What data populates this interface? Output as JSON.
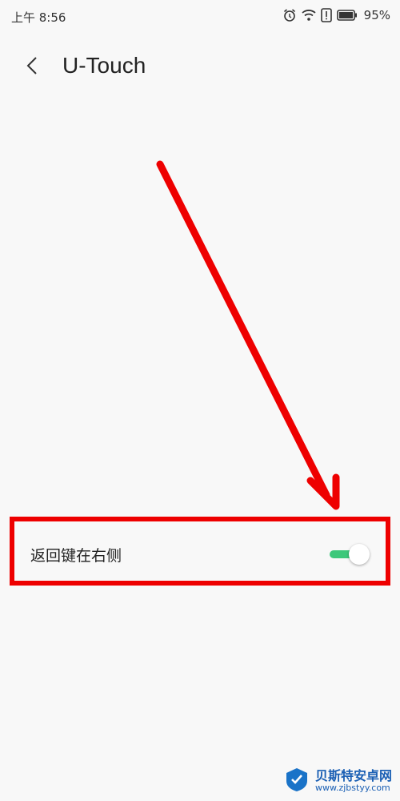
{
  "status_bar": {
    "time": "上午 8:56",
    "battery": "95%",
    "icons": [
      "alarm-icon",
      "wifi-icon",
      "alert-icon",
      "battery-icon"
    ]
  },
  "header": {
    "back_icon": "chevron-left-icon",
    "title": "U-Touch"
  },
  "setting": {
    "label": "返回键在右侧",
    "toggle_on": true,
    "toggle_color": "#3cc87a"
  },
  "annotation": {
    "color": "#ee0000"
  },
  "watermark": {
    "name": "贝斯特安卓网",
    "url": "www.zjbstyy.com"
  }
}
